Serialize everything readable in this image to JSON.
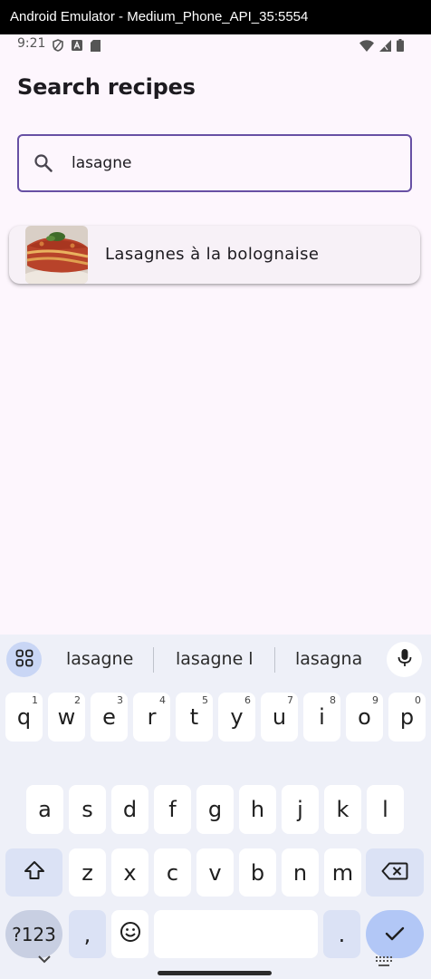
{
  "window": {
    "title": "Android Emulator - Medium_Phone_API_35:5554"
  },
  "status_bar": {
    "time": "9:21",
    "left_icons": [
      "shield-icon",
      "font-a-icon",
      "sd-card-icon"
    ],
    "right_icons": [
      "wifi-icon",
      "cell-signal-icon",
      "battery-icon"
    ]
  },
  "page": {
    "title": "Search recipes"
  },
  "search": {
    "value": "lasagne",
    "placeholder": ""
  },
  "results": [
    {
      "label": "Lasagnes à la bolognaise",
      "thumb": "lasagna-photo"
    }
  ],
  "keyboard": {
    "suggestions": [
      "lasagne",
      "lasagne l",
      "lasagna"
    ],
    "row1": [
      {
        "k": "q",
        "h": "1"
      },
      {
        "k": "w",
        "h": "2"
      },
      {
        "k": "e",
        "h": "3"
      },
      {
        "k": "r",
        "h": "4"
      },
      {
        "k": "t",
        "h": "5"
      },
      {
        "k": "y",
        "h": "6"
      },
      {
        "k": "u",
        "h": "7"
      },
      {
        "k": "i",
        "h": "8"
      },
      {
        "k": "o",
        "h": "9"
      },
      {
        "k": "p",
        "h": "0"
      }
    ],
    "row2": [
      "a",
      "s",
      "d",
      "f",
      "g",
      "h",
      "j",
      "k",
      "l"
    ],
    "row3": [
      "z",
      "x",
      "c",
      "v",
      "b",
      "n",
      "m"
    ],
    "symbols_label": "?123",
    "comma_label": ",",
    "period_label": ".",
    "emoji_icon": "emoji-icon",
    "shift_icon": "shift-icon",
    "backspace_icon": "backspace-icon",
    "enter_icon": "checkmark-icon"
  },
  "colors": {
    "accent": "#6750a4",
    "screen_bg": "#fdf6fd",
    "keyboard_bg": "#eef0f8",
    "enter_key": "#b2c7f6"
  }
}
